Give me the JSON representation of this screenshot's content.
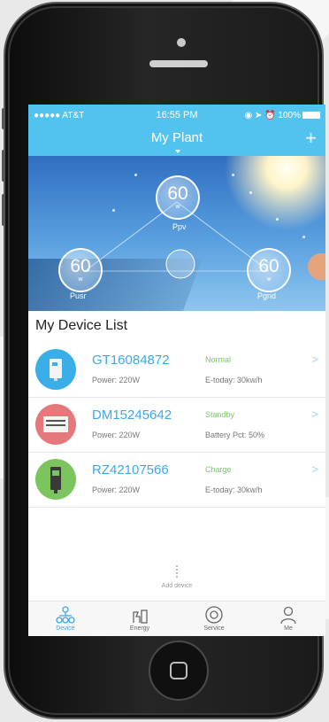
{
  "status_bar": {
    "carrier": "●●●●● AT&T",
    "time": "16:55 PM",
    "battery": "100%"
  },
  "navbar": {
    "title": "My Plant",
    "add_icon": "plus-icon"
  },
  "hero": {
    "ppv": {
      "value": "60",
      "unit": "w",
      "label": "Ppv"
    },
    "pusr": {
      "value": "60",
      "unit": "w",
      "label": "Pusr"
    },
    "pgrid": {
      "value": "60",
      "unit": "w",
      "label": "Pgrid"
    }
  },
  "device_list": {
    "title": "My Device List",
    "devices": [
      {
        "name": "GT16084872",
        "status": "Normal",
        "power": "Power: 220W",
        "extra": "E-today: 30kw/h",
        "icon_color": "#3aaee8",
        "icon": "inverter-icon"
      },
      {
        "name": "DM15245642",
        "status": "Standby",
        "power": "Power: 220W",
        "extra": "Battery Pct: 50%",
        "icon_color": "#e4787a",
        "icon": "battery-box-icon"
      },
      {
        "name": "RZ42107566",
        "status": "Charge",
        "power": "Power: 220W",
        "extra": "E-today: 30kw/h",
        "icon_color": "#7cc45d",
        "icon": "charger-icon"
      }
    ]
  },
  "add_device": {
    "label": "Add device"
  },
  "tabs": [
    {
      "label": "Device",
      "icon": "device-tree-icon",
      "active": true
    },
    {
      "label": "Energy",
      "icon": "energy-icon",
      "active": false
    },
    {
      "label": "Service",
      "icon": "service-icon",
      "active": false
    },
    {
      "label": "Me",
      "icon": "person-icon",
      "active": false
    }
  ],
  "colors": {
    "accent": "#52c3ee",
    "link": "#3da8e6",
    "status_green": "#7bc66a"
  }
}
